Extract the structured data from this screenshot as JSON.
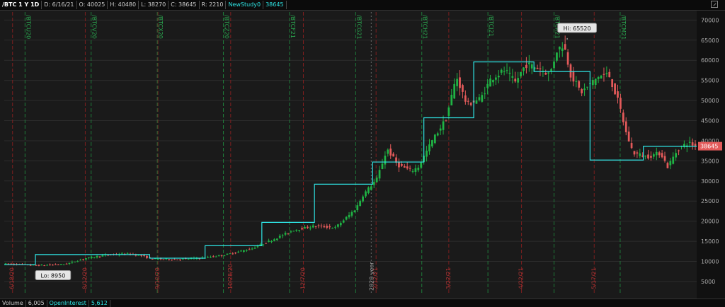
{
  "header": {
    "symbol": "/BTC 1 Y 1D",
    "date": "D: 6/16/21",
    "open": "O: 40025",
    "high": "H: 40480",
    "low": "L: 38270",
    "close": "C: 38645",
    "range": "R: 2210",
    "study_name": "NewStudy0",
    "study_value": "38645"
  },
  "footer": {
    "volume_label": "Volume",
    "volume_value": "6,005",
    "oi_label": "OpenInterest",
    "oi_value": "5,612"
  },
  "colors": {
    "background": "#1a1a1a",
    "grid": "#2c2c2c",
    "up": "#1fb344",
    "down": "#e35a5a",
    "study": "#2ee6e6",
    "expiry_line": "#1f7a3a",
    "month_line": "#7a1f1f"
  },
  "chart_data": {
    "type": "candlestick",
    "y_ticks": [
      5000,
      10000,
      15000,
      20000,
      25000,
      30000,
      35000,
      40000,
      45000,
      50000,
      55000,
      60000,
      65000,
      70000
    ],
    "ylim": [
      2000,
      72000
    ],
    "price_label": "38645",
    "hi_label": "Hi: 65520",
    "lo_label": "Lo: 8950",
    "year_label": "2020 year",
    "contract_labels": [
      "/BTCU20",
      "/BTCV20",
      "/BTCX20",
      "/BTCZ20",
      "/BTCF21",
      "/BTCG21",
      "/BTCH21",
      "/BTCJ21",
      "/BTCK21",
      "/BTCM21"
    ],
    "date_labels": [
      "6/18/20",
      "8/12/20",
      "9/10/20",
      "10/28/20",
      "12/7/20",
      "2/12/21",
      "3/22/21",
      "4/22/21",
      "5/17/21"
    ],
    "study_steps": [
      {
        "from": 0,
        "to": 0.045,
        "value": 9200
      },
      {
        "from": 0.045,
        "to": 0.21,
        "value": 11700
      },
      {
        "from": 0.21,
        "to": 0.29,
        "value": 10800
      },
      {
        "from": 0.29,
        "to": 0.372,
        "value": 13900
      },
      {
        "from": 0.372,
        "to": 0.448,
        "value": 19700
      },
      {
        "from": 0.448,
        "to": 0.532,
        "value": 29200
      },
      {
        "from": 0.532,
        "to": 0.606,
        "value": 34700
      },
      {
        "from": 0.606,
        "to": 0.678,
        "value": 45700
      },
      {
        "from": 0.678,
        "to": 0.765,
        "value": 59600
      },
      {
        "from": 0.765,
        "to": 0.846,
        "value": 57200
      },
      {
        "from": 0.846,
        "to": 0.923,
        "value": 35200
      },
      {
        "from": 0.923,
        "to": 1.0,
        "value": 38600
      }
    ],
    "anchors": [
      [
        0,
        9400
      ],
      [
        0.03,
        9200
      ],
      [
        0.05,
        9000
      ],
      [
        0.09,
        9300
      ],
      [
        0.12,
        10800
      ],
      [
        0.15,
        11600
      ],
      [
        0.18,
        11900
      ],
      [
        0.2,
        11400
      ],
      [
        0.215,
        10600
      ],
      [
        0.25,
        10500
      ],
      [
        0.29,
        10900
      ],
      [
        0.32,
        11600
      ],
      [
        0.36,
        13200
      ],
      [
        0.39,
        15400
      ],
      [
        0.42,
        17800
      ],
      [
        0.45,
        18800
      ],
      [
        0.48,
        18400
      ],
      [
        0.5,
        21500
      ],
      [
        0.51,
        23200
      ],
      [
        0.52,
        26500
      ],
      [
        0.54,
        30500
      ],
      [
        0.555,
        38000
      ],
      [
        0.57,
        34000
      ],
      [
        0.59,
        32500
      ],
      [
        0.6,
        33500
      ],
      [
        0.62,
        40000
      ],
      [
        0.64,
        45500
      ],
      [
        0.655,
        56000
      ],
      [
        0.67,
        49000
      ],
      [
        0.69,
        50500
      ],
      [
        0.705,
        55500
      ],
      [
        0.725,
        57500
      ],
      [
        0.74,
        54500
      ],
      [
        0.755,
        59000
      ],
      [
        0.775,
        58000
      ],
      [
        0.79,
        56500
      ],
      [
        0.8,
        62500
      ],
      [
        0.81,
        64000
      ],
      [
        0.82,
        56500
      ],
      [
        0.835,
        52000
      ],
      [
        0.845,
        53500
      ],
      [
        0.86,
        56000
      ],
      [
        0.875,
        56500
      ],
      [
        0.89,
        49000
      ],
      [
        0.9,
        42000
      ],
      [
        0.91,
        37000
      ],
      [
        0.93,
        36000
      ],
      [
        0.95,
        37000
      ],
      [
        0.96,
        33500
      ],
      [
        0.975,
        38000
      ],
      [
        0.99,
        39500
      ],
      [
        1.0,
        38645
      ]
    ]
  }
}
